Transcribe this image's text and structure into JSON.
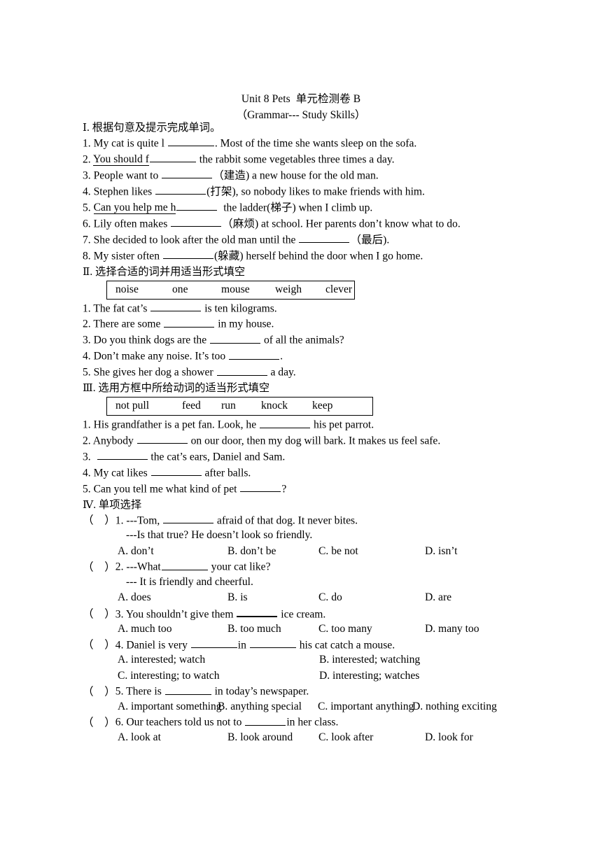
{
  "document": {
    "title": "Unit 8 Pets  单元检测卷 B",
    "subtitle": "（Grammar--- Study Skills）"
  },
  "sections": {
    "one": {
      "heading": "Ⅰ. 根据句意及提示完成单词。",
      "items": [
        {
          "num": "1.",
          "before": "My cat is quite l ",
          "after": ". Most of the time she wants sleep on the sofa."
        },
        {
          "num": "2.",
          "before": "You should f",
          "after": " the rabbit some vegetables three times a day."
        },
        {
          "num": "3.",
          "before": "People want to ",
          "after": "（建造) a new house for the old man."
        },
        {
          "num": "4.",
          "before": "Stephen likes ",
          "after": "(打架), so nobody likes to make friends with him."
        },
        {
          "num": "5.",
          "before": "Can you help me h",
          "after": "  the ladder(梯子) when I climb up."
        },
        {
          "num": "6.",
          "before": "Lily often makes ",
          "after": "（麻烦) at school. Her parents don’t know what to do."
        },
        {
          "num": "7.",
          "before": "She decided to look after the old man until the ",
          "after": "（最后)."
        },
        {
          "num": "8.",
          "before": "My sister often ",
          "after": "(躲藏) herself behind the door when I go home."
        }
      ]
    },
    "two": {
      "heading": "Ⅱ. 选择合适的词并用适当形式填空",
      "wordbank": [
        "noise",
        "one",
        "mouse",
        "weigh",
        "clever"
      ],
      "items": [
        {
          "num": "1.",
          "before": "The fat cat’s ",
          "after": " is ten kilograms."
        },
        {
          "num": "2.",
          "before": "There are some ",
          "after": " in my house."
        },
        {
          "num": "3.",
          "before": "Do you think dogs are the ",
          "after": " of all the animals?"
        },
        {
          "num": "4.",
          "before": "Don’t make any noise. It’s too ",
          "after": "."
        },
        {
          "num": "5.",
          "before": "She gives her dog a shower ",
          "after": " a day."
        }
      ]
    },
    "three": {
      "heading": "Ⅲ. 选用方框中所给动词的适当形式填空",
      "wordbank": [
        "not pull",
        "feed",
        "run",
        "knock",
        "keep"
      ],
      "items": [
        {
          "num": "1.",
          "before": "His grandfather is a pet fan. Look, he ",
          "after": " his pet parrot."
        },
        {
          "num": "2.",
          "before": "Anybody ",
          "after": " on our door, then my dog will bark. It makes us feel safe."
        },
        {
          "num": "3.",
          "before": " ",
          "after": " the cat’s ears, Daniel and Sam."
        },
        {
          "num": "4.",
          "before": "My cat likes ",
          "after": " after balls."
        },
        {
          "num": "5.",
          "before": "Can you tell me what kind of pet ",
          "after": "?"
        }
      ]
    },
    "four": {
      "heading": "Ⅳ. 单项选择",
      "paren": "（    ）",
      "questions": [
        {
          "num": "1.",
          "stem_before": "---Tom, ",
          "stem_after": " afraid of that dog. It never bites.",
          "second_line": "---Is that true? He doesn’t look so friendly.",
          "options": [
            "A. don’t",
            "B. don’t be",
            "C. be not",
            "D. isn’t"
          ],
          "layout": "row4"
        },
        {
          "num": "2.",
          "stem_before": "---What",
          "stem_after": " your cat like?",
          "second_line": "--- It is friendly and cheerful.",
          "options": [
            "A. does",
            "B. is",
            "C. do",
            "D. are"
          ],
          "layout": "row4"
        },
        {
          "num": "3.",
          "stem_before": "You shouldn’t give them ",
          "stem_after": " ice cream.",
          "second_line": "",
          "options": [
            "A. much too",
            "B. too much",
            "C. too many",
            "D. many too"
          ],
          "layout": "row4"
        },
        {
          "num": "4.",
          "stem_before": "Daniel is very ",
          "stem_mid": "in ",
          "stem_after": " his cat catch a mouse.",
          "second_line": "",
          "options": [
            "A. interested; watch",
            "B. interested; watching",
            "C. interesting; to watch",
            "D. interesting; watches"
          ],
          "layout": "grid2"
        },
        {
          "num": "5.",
          "stem_before": "There is ",
          "stem_after": " in today’s newspaper.",
          "second_line": "",
          "options": [
            "A. important something",
            "B. anything special",
            "C. important anything",
            "D. nothing exciting"
          ],
          "layout": "row4wide"
        },
        {
          "num": "6.",
          "stem_before": "Our teachers told us not to ",
          "stem_after": "in her class.",
          "second_line": "",
          "options": [
            "A. look at",
            "B. look around",
            "C. look after",
            "D. look for"
          ],
          "layout": "row4"
        }
      ]
    }
  }
}
